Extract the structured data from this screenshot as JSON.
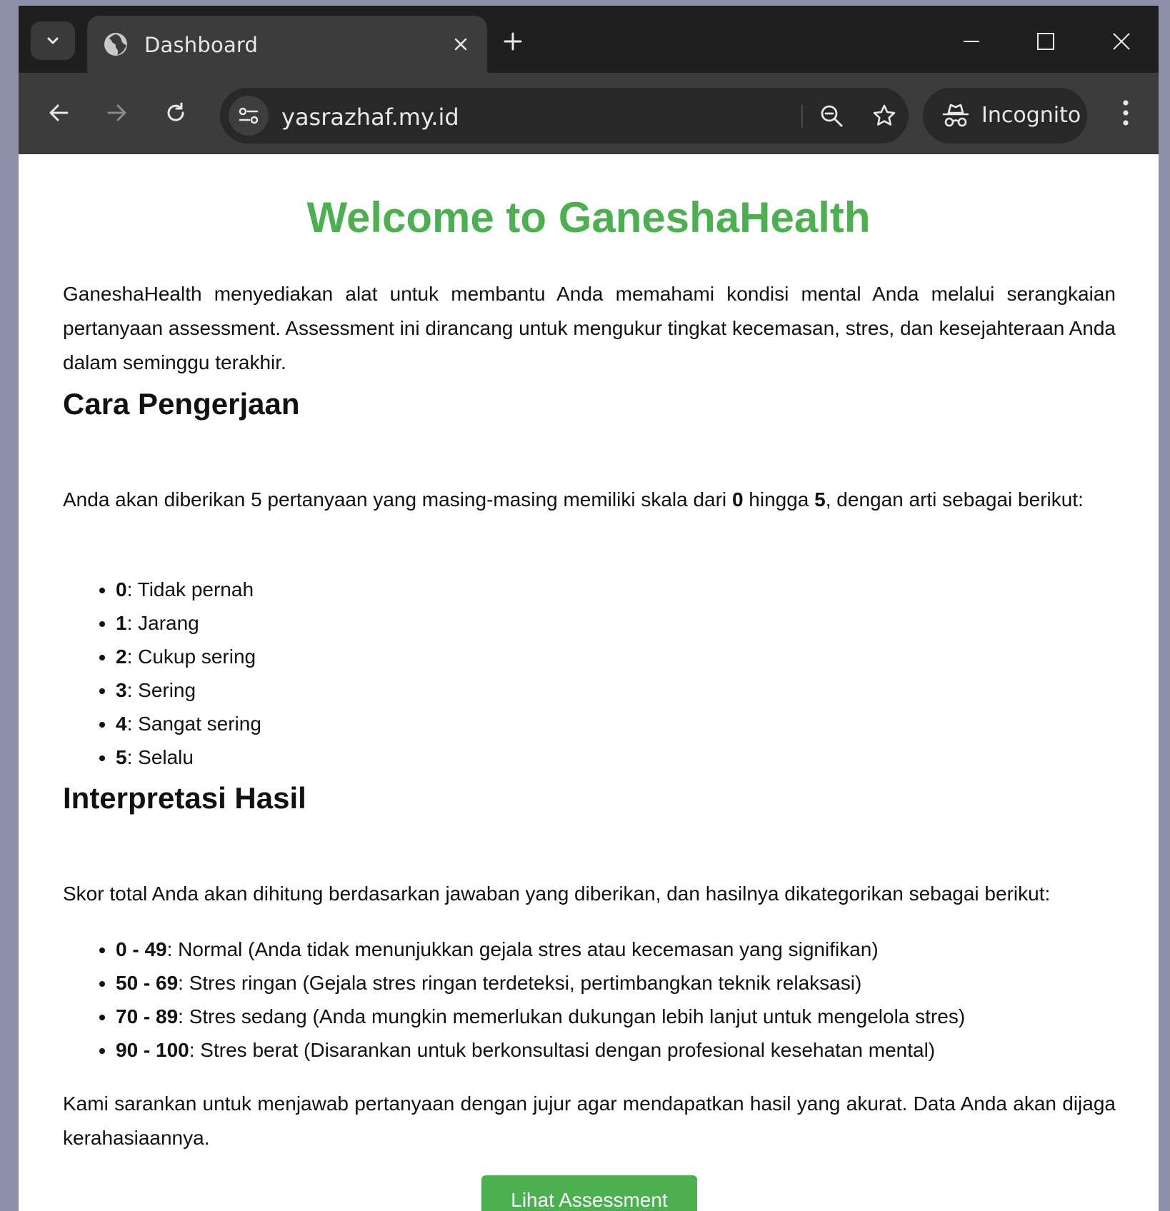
{
  "browser": {
    "tab": {
      "title": "Dashboard"
    },
    "address_bar": {
      "url": "yasrazhaf.my.id"
    },
    "profile": {
      "label": "Incognito"
    },
    "colors": {
      "tabstrip": "#1f1f1f",
      "toolbar": "#3c3c3c",
      "omnibox": "#282828",
      "accent": "#4caf50"
    }
  },
  "page": {
    "title": "Welcome to GaneshaHealth",
    "intro": "GaneshaHealth menyediakan alat untuk membantu Anda memahami kondisi mental Anda melalui serangkaian pertanyaan assessment. Assessment ini dirancang untuk mengukur tingkat kecemasan, stres, dan kesejahteraan Anda dalam seminggu terakhir.",
    "section1": {
      "heading": "Cara Pengerjaan",
      "text_before": "Anda akan diberikan 5 pertanyaan yang masing-masing memiliki skala dari ",
      "scale_min": "0",
      "text_middle": " hingga ",
      "scale_max": "5",
      "text_after": ", dengan arti sebagai berikut:",
      "items": [
        {
          "key": "0",
          "label": ": Tidak pernah"
        },
        {
          "key": "1",
          "label": ": Jarang"
        },
        {
          "key": "2",
          "label": ": Cukup sering"
        },
        {
          "key": "3",
          "label": ": Sering"
        },
        {
          "key": "4",
          "label": ": Sangat sering"
        },
        {
          "key": "5",
          "label": ": Selalu"
        }
      ]
    },
    "section2": {
      "heading": "Interpretasi Hasil",
      "text": "Skor total Anda akan dihitung berdasarkan jawaban yang diberikan, dan hasilnya dikategorikan sebagai berikut:",
      "items": [
        {
          "range": "0 - 49",
          "label": ": Normal (Anda tidak menunjukkan gejala stres atau kecemasan yang signifikan)"
        },
        {
          "range": "50 - 69",
          "label": ": Stres ringan (Gejala stres ringan terdeteksi, pertimbangkan teknik relaksasi)"
        },
        {
          "range": "70 - 89",
          "label": ": Stres sedang (Anda mungkin memerlukan dukungan lebih lanjut untuk mengelola stres)"
        },
        {
          "range": "90 - 100",
          "label": ": Stres berat (Disarankan untuk berkonsultasi dengan profesional kesehatan mental)"
        }
      ]
    },
    "closing": "Kami sarankan untuk menjawab pertanyaan dengan jujur agar mendapatkan hasil yang akurat. Data Anda akan dijaga kerahasiaannya.",
    "cta_label": "Lihat Assessment"
  }
}
